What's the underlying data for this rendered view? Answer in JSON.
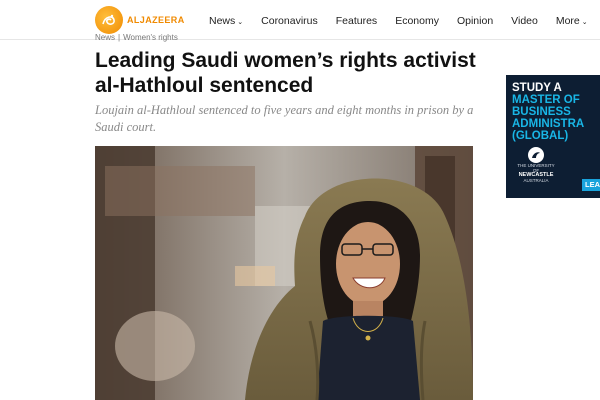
{
  "header": {
    "logo_text": "ALJAZEERA",
    "nav": [
      {
        "label": "News",
        "has_dropdown": true
      },
      {
        "label": "Coronavirus",
        "has_dropdown": false
      },
      {
        "label": "Features",
        "has_dropdown": false
      },
      {
        "label": "Economy",
        "has_dropdown": false
      },
      {
        "label": "Opinion",
        "has_dropdown": false
      },
      {
        "label": "Video",
        "has_dropdown": false
      },
      {
        "label": "More",
        "has_dropdown": true
      }
    ]
  },
  "breadcrumb": [
    "News",
    "Women's rights"
  ],
  "article": {
    "headline": "Leading Saudi women’s rights activist al-Hathloul sentenced",
    "subtitle": "Loujain al-Hathloul sentenced to five years and eight months in prison by a Saudi court."
  },
  "ad": {
    "line1": "STUDY A",
    "line2": "MASTER OF",
    "line3": "BUSINESS",
    "line4": "ADMINISTRA",
    "line5": "(GLOBAL)",
    "university_prefix": "THE UNIVERSITY OF",
    "university_name": "NEWCASTLE",
    "university_country": "AUSTRALIA",
    "cta": "LEAR"
  },
  "colors": {
    "brand_orange": "#f08a00",
    "ad_background": "#0d1e33",
    "ad_cyan": "#19b6e6"
  }
}
